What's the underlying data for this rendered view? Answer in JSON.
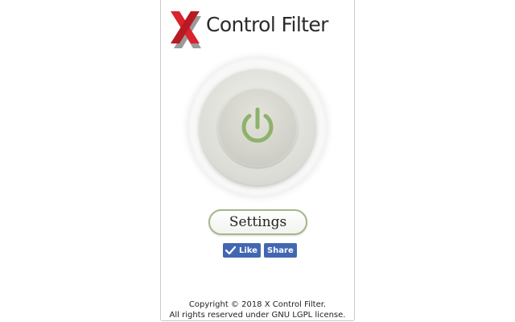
{
  "app": {
    "logo_text": "Control Filter",
    "logo_letter": "X"
  },
  "power": {
    "icon": "power-icon",
    "accent": "#8db36b"
  },
  "settings": {
    "label": "Settings"
  },
  "social": {
    "like_label": "Like",
    "share_label": "Share",
    "like_icon": "check-icon",
    "color": "#4267b2"
  },
  "footer": {
    "line1": "Copyright © 2018 X Control Filter.",
    "line2": "All rights reserved under GNU LGPL license."
  }
}
